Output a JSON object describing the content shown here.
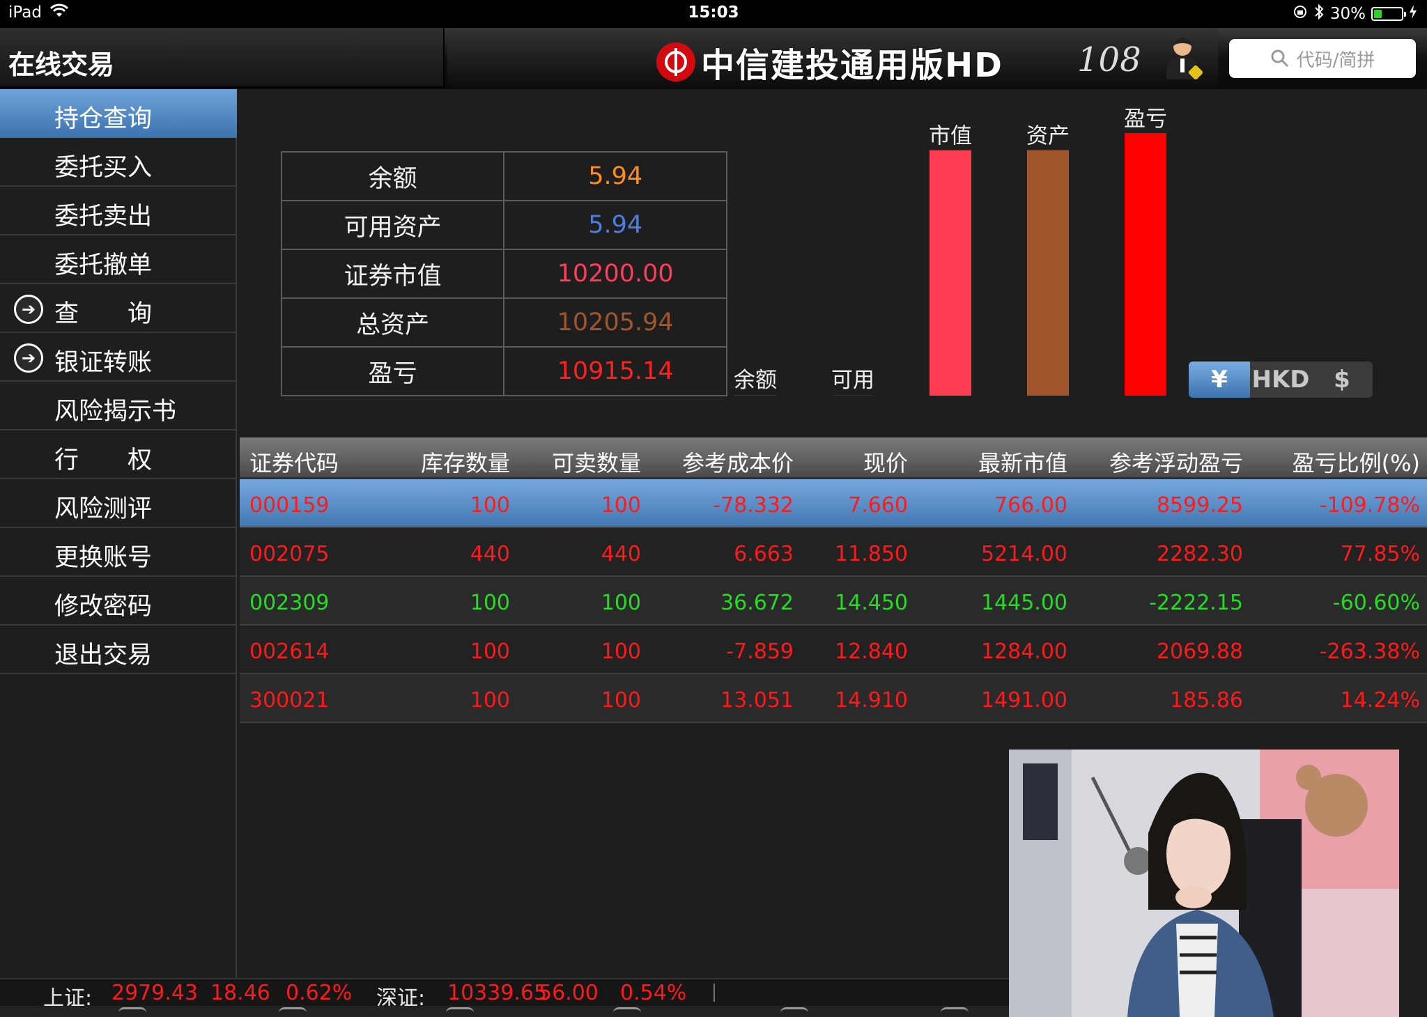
{
  "status_bar": {
    "device": "iPad",
    "time": "15:03",
    "battery": "30%",
    "battery_level": 0.3
  },
  "header": {
    "title": "在线交易",
    "brand": "中信建投通用版HD",
    "signature": "108",
    "search_placeholder": "代码/简拼"
  },
  "sidebar": {
    "items": [
      {
        "label": "持仓查询",
        "active": true,
        "icon": ""
      },
      {
        "label": "委托买入",
        "icon": ""
      },
      {
        "label": "委托卖出",
        "icon": ""
      },
      {
        "label": "委托撤单",
        "icon": ""
      },
      {
        "label": "查　　询",
        "icon": "arrow-circle-icon"
      },
      {
        "label": "银证转账",
        "icon": "arrow-circle-icon"
      },
      {
        "label": "风险揭示书",
        "icon": ""
      },
      {
        "label": "行　　权",
        "icon": ""
      },
      {
        "label": "风险测评",
        "icon": ""
      },
      {
        "label": "更换账号",
        "icon": ""
      },
      {
        "label": "修改密码",
        "icon": ""
      },
      {
        "label": "退出交易",
        "icon": ""
      }
    ]
  },
  "summary": {
    "rows": [
      {
        "label": "余额",
        "value": "5.94",
        "color": "#ff8c1a"
      },
      {
        "label": "可用资产",
        "value": "5.94",
        "color": "#4a7ee0"
      },
      {
        "label": "证券市值",
        "value": "10200.00",
        "color": "#ff3c5a"
      },
      {
        "label": "总资产",
        "value": "10205.94",
        "color": "#a0562a"
      },
      {
        "label": "盈亏",
        "value": "10915.14",
        "color": "#ff2020"
      }
    ]
  },
  "chart_data": {
    "type": "bar",
    "categories": [
      "余额",
      "可用",
      "市值",
      "资产",
      "盈亏"
    ],
    "values": [
      5.94,
      5.94,
      10200.0,
      10205.94,
      10915.14
    ],
    "colors": [
      "#ff8c1a",
      "#4a7ee0",
      "#ff3c50",
      "#a0562a",
      "#ff0000"
    ],
    "ylim": [
      0,
      10915.14
    ],
    "grid": false,
    "title": "",
    "xlabel": "",
    "ylabel": ""
  },
  "currency": {
    "options": [
      "¥",
      "HKD",
      "$"
    ],
    "selected": "¥"
  },
  "holdings": {
    "columns": [
      "证券代码",
      "库存数量",
      "可卖数量",
      "参考成本价",
      "现价",
      "最新市值",
      "参考浮动盈亏",
      "盈亏比例(%)"
    ],
    "rows": [
      {
        "cells": [
          "000159",
          "100",
          "100",
          "-78.332",
          "7.660",
          "766.00",
          "8599.25",
          "-109.78%"
        ],
        "color": "#ff1a1a",
        "selected": true
      },
      {
        "cells": [
          "002075",
          "440",
          "440",
          "6.663",
          "11.850",
          "5214.00",
          "2282.30",
          "77.85%"
        ],
        "color": "#ff1a1a"
      },
      {
        "cells": [
          "002309",
          "100",
          "100",
          "36.672",
          "14.450",
          "1445.00",
          "-2222.15",
          "-60.60%"
        ],
        "color": "#22dd22"
      },
      {
        "cells": [
          "002614",
          "100",
          "100",
          "-7.859",
          "12.840",
          "1284.00",
          "2069.88",
          "-263.38%"
        ],
        "color": "#ff1a1a"
      },
      {
        "cells": [
          "300021",
          "100",
          "100",
          "13.051",
          "14.910",
          "1491.00",
          "185.86",
          "14.24%"
        ],
        "color": "#ff1a1a"
      }
    ]
  },
  "ticker": {
    "sh_label": "上证:",
    "sh_value": "2979.43",
    "sh_change": "18.46",
    "sh_pct": "0.62%",
    "sz_label": "深证:",
    "sz_value": "10339.65",
    "sz_change": "56.00",
    "sz_pct": "0.54%",
    "color": "#ff1a1a"
  }
}
